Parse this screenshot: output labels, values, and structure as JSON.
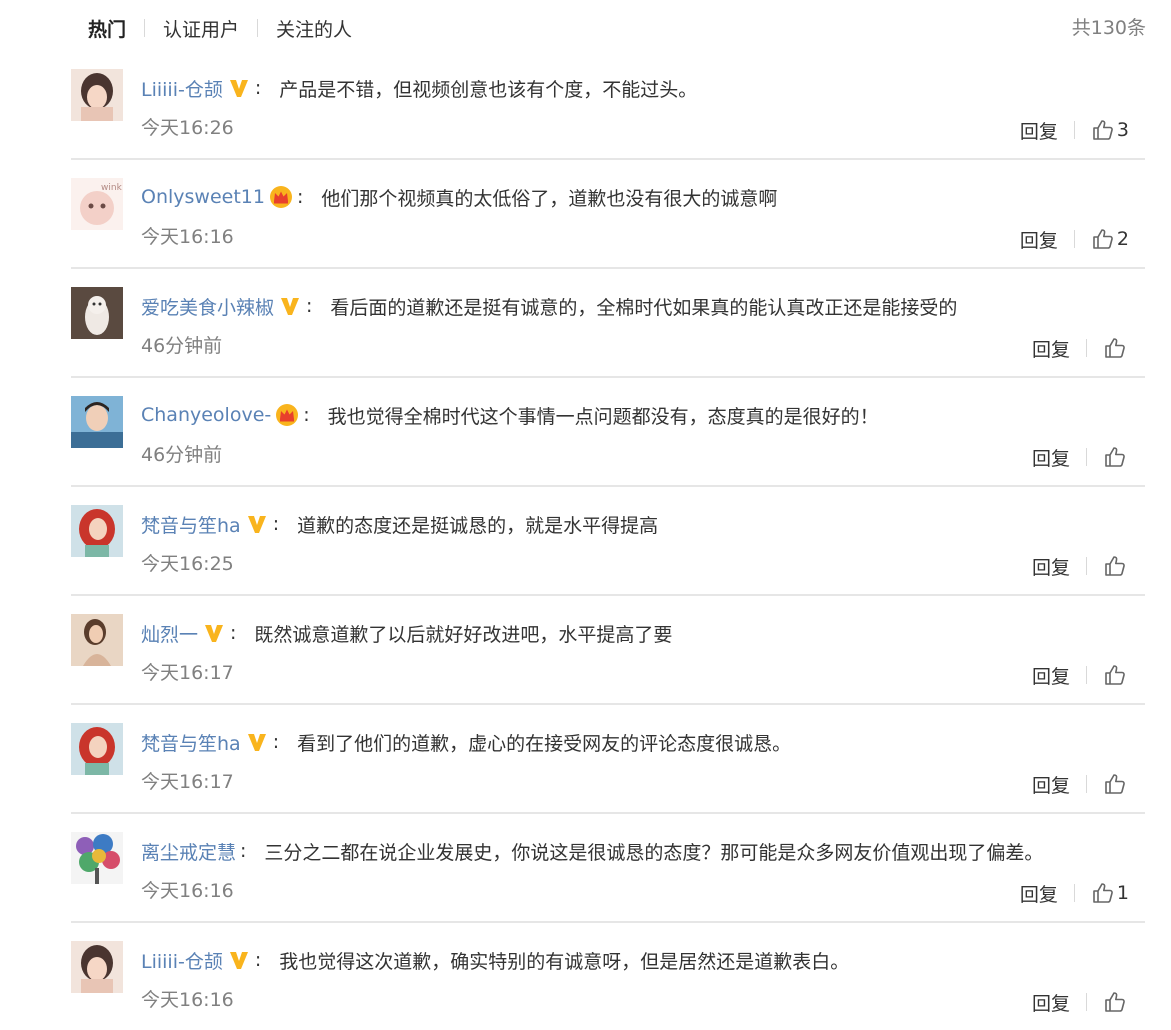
{
  "tabs": [
    "热门",
    "认证用户",
    "关注的人"
  ],
  "total": "共130条",
  "reply_label": "回复",
  "colors": {
    "username": "#5a82b5",
    "meta": "#808080",
    "badge_v": "#f9b41d",
    "divider": "#e6e6e6"
  },
  "comments": [
    {
      "user": "Liiiii-仓颉",
      "badge": "vip-v-icon",
      "text": "产品是不错，但视频创意也该有个度，不能过头。",
      "time": "今天16:26",
      "likes": "3"
    },
    {
      "user": "Onlysweet11",
      "badge": "crown-icon",
      "text": "他们那个视频真的太低俗了，道歉也没有很大的诚意啊",
      "time": "今天16:16",
      "likes": "2"
    },
    {
      "user": "爱吃美食小辣椒",
      "badge": "vip-v-icon",
      "text": "看后面的道歉还是挺有诚意的，全棉时代如果真的能认真改正还是能接受的",
      "time": "46分钟前",
      "likes": ""
    },
    {
      "user": "Chanyeolove-",
      "badge": "crown-icon",
      "text": "我也觉得全棉时代这个事情一点问题都没有，态度真的是很好的！",
      "time": "46分钟前",
      "likes": ""
    },
    {
      "user": "梵音与笙ha",
      "badge": "vip-v-icon",
      "text": "道歉的态度还是挺诚恳的，就是水平得提高",
      "time": "今天16:25",
      "likes": ""
    },
    {
      "user": "灿烈一",
      "badge": "vip-v-icon",
      "text": "既然诚意道歉了以后就好好改进吧，水平提高了要",
      "time": "今天16:17",
      "likes": ""
    },
    {
      "user": "梵音与笙ha",
      "badge": "vip-v-icon",
      "text": "看到了他们的道歉，虚心的在接受网友的评论态度很诚恳。",
      "time": "今天16:17",
      "likes": ""
    },
    {
      "user": "离尘戒定慧",
      "badge": "",
      "text": "三分之二都在说企业发展史，你说这是很诚恳的态度？那可能是众多网友价值观出现了偏差。",
      "time": "今天16:16",
      "likes": "1"
    },
    {
      "user": "Liiiii-仓颉",
      "badge": "vip-v-icon",
      "text": "我也觉得这次道歉，确实特别的有诚意呀，但是居然还是道歉表白。",
      "time": "今天16:16",
      "likes": ""
    }
  ]
}
